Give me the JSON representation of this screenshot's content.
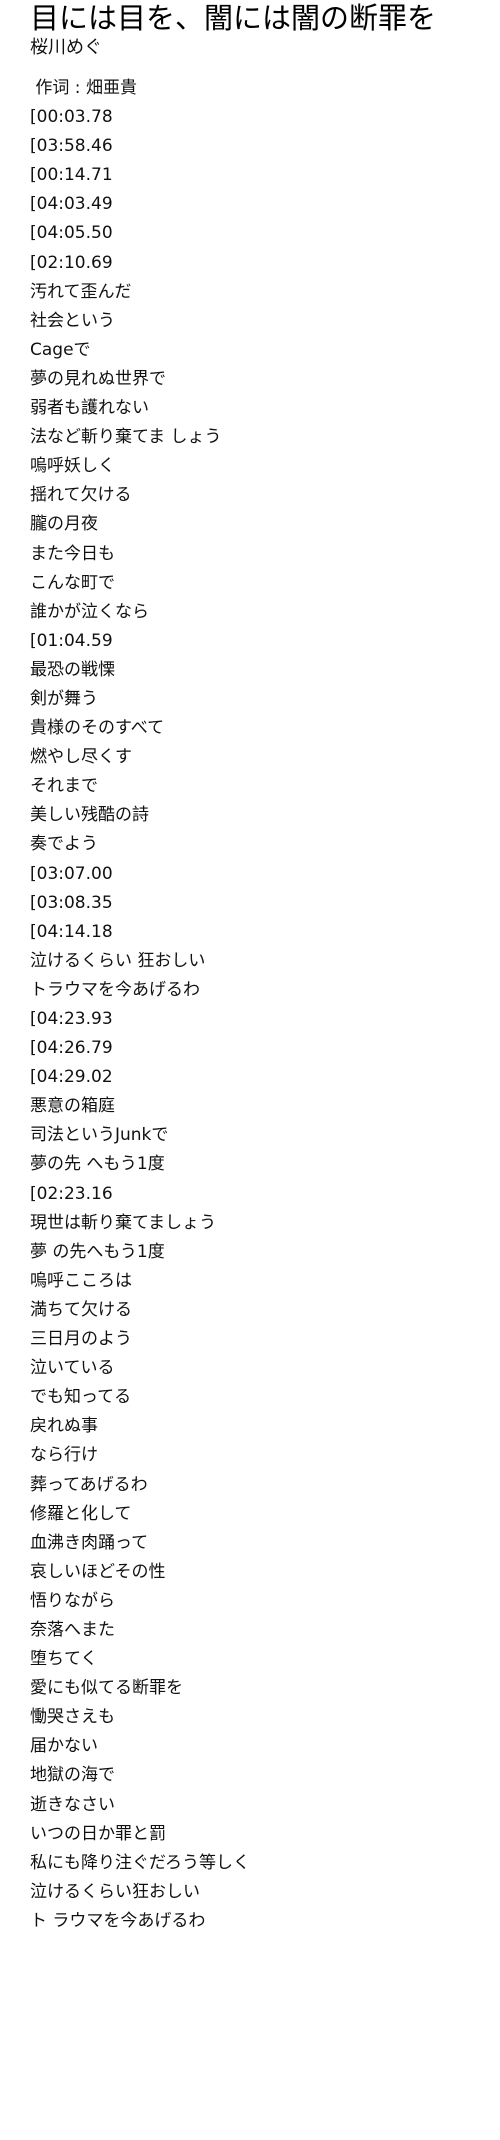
{
  "song": {
    "title": "目には目を、闇には闇の断罪を",
    "artist": "桜川めぐ"
  },
  "lyrics": [
    " 作词 : 畑亜貴",
    "[00:03.78",
    "[03:58.46",
    "[00:14.71",
    "[04:03.49",
    "[04:05.50",
    "[02:10.69",
    "汚れて歪んだ",
    "社会という",
    "Cageで",
    "夢の見れぬ世界で",
    "弱者も護れない",
    "法など斬り棄てま しょう",
    "嗚呼妖しく",
    "揺れて欠ける",
    "朧の月夜",
    "また今日も",
    "こんな町で",
    "誰かが泣くなら",
    "[01:04.59",
    "最恐の戦慄",
    "剣が舞う",
    "貴様のそのすべて",
    "燃やし尽くす",
    "それまで",
    "美しい残酷の詩",
    "奏でよう",
    "[03:07.00",
    "[03:08.35",
    "[04:14.18",
    "泣けるくらい 狂おしい",
    "トラウマを今あげるわ",
    "[04:23.93",
    "[04:26.79",
    "[04:29.02",
    "悪意の箱庭",
    "司法というJunkで",
    "夢の先 へもう1度",
    "[02:23.16",
    "現世は斬り棄てましょう",
    "夢 の先へもう1度",
    "嗚呼こころは",
    "満ちて欠ける",
    "三日月のよう",
    "泣いている",
    "でも知ってる",
    "戻れぬ事",
    "なら行け",
    "葬ってあげるわ",
    "修羅と化して",
    "血沸き肉踊って",
    "哀しいほどその性",
    "悟りながら",
    "奈落へまた",
    "堕ちてく",
    "愛にも似てる断罪を",
    "慟哭さえも",
    "届かない",
    "地獄の海で",
    "逝きなさい",
    "いつの日か罪と罰",
    "私にも降り注ぐだろう等しく",
    "泣けるくらい狂おしい",
    "ト ラウマを今あげるわ"
  ]
}
